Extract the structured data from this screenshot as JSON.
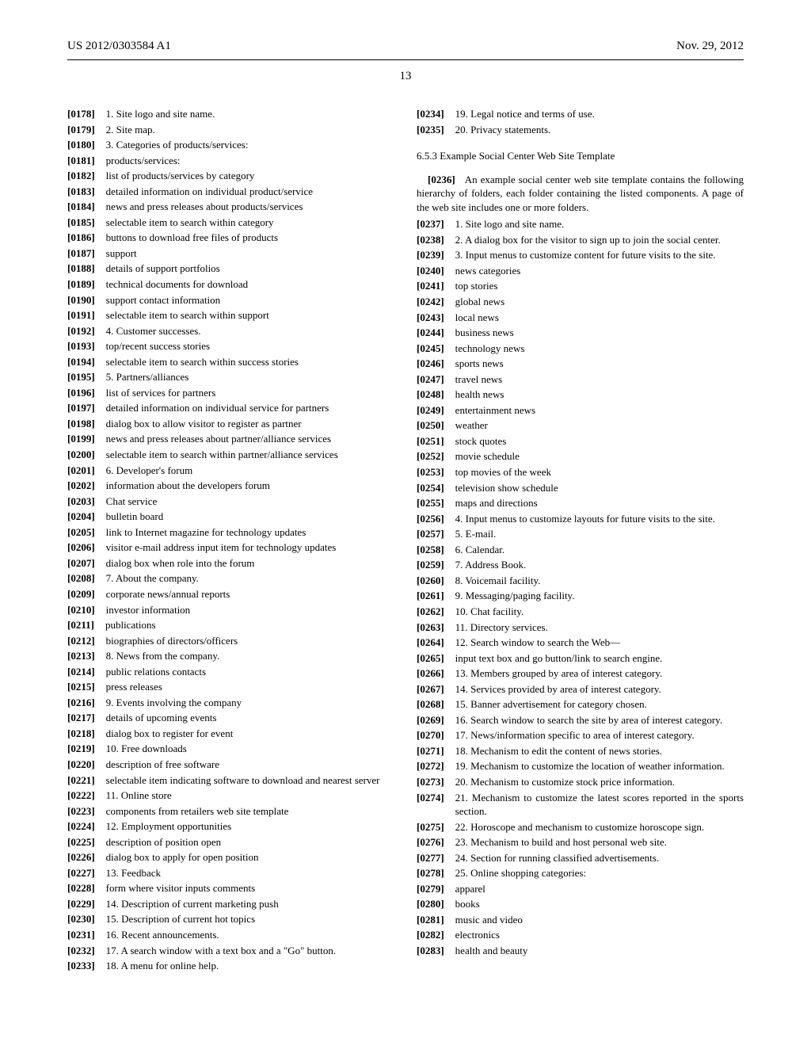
{
  "header": {
    "pubno": "US 2012/0303584 A1",
    "date": "Nov. 29, 2012",
    "page": "13"
  },
  "section_title": "6.5.3 Example Social Center Web Site Template",
  "c1": [
    {
      "n": "[0178]",
      "t": "1. Site logo and site name.",
      "i": 0
    },
    {
      "n": "[0179]",
      "t": "2. Site map.",
      "i": 0
    },
    {
      "n": "[0180]",
      "t": "3. Categories of products/services:",
      "i": 0
    },
    {
      "n": "[0181]",
      "t": "products/services:",
      "i": 1
    },
    {
      "n": "[0182]",
      "t": "list of products/services by category",
      "i": 2
    },
    {
      "n": "[0183]",
      "t": "detailed information on individual product/service",
      "i": 2,
      "cont": 2
    },
    {
      "n": "[0184]",
      "t": "news and press releases about products/services",
      "i": 2,
      "cont": 2
    },
    {
      "n": "[0185]",
      "t": "selectable item to search within category",
      "i": 2
    },
    {
      "n": "[0186]",
      "t": "buttons to download free files of products",
      "i": 2
    },
    {
      "n": "[0187]",
      "t": "support",
      "i": 1
    },
    {
      "n": "[0188]",
      "t": "details of support portfolios",
      "i": 1
    },
    {
      "n": "[0189]",
      "t": "technical documents for download",
      "i": 1
    },
    {
      "n": "[0190]",
      "t": "support contact information",
      "i": 1
    },
    {
      "n": "[0191]",
      "t": "selectable item to search within support",
      "i": 2
    },
    {
      "n": "[0192]",
      "t": "4. Customer successes.",
      "i": 0
    },
    {
      "n": "[0193]",
      "t": "top/recent success stories",
      "i": 1
    },
    {
      "n": "[0194]",
      "t": "selectable item to search within success stories",
      "i": 2
    },
    {
      "n": "[0195]",
      "t": "5. Partners/alliances",
      "i": 0
    },
    {
      "n": "[0196]",
      "t": "list of services for partners",
      "i": 1
    },
    {
      "n": "[0197]",
      "t": "detailed information on individual service for partners",
      "i": 1,
      "cont": 1
    },
    {
      "n": "[0198]",
      "t": "dialog box to allow visitor to register as partner",
      "i": 1
    },
    {
      "n": "[0199]",
      "t": "news and press releases about partner/alliance services",
      "i": 1,
      "cont": 1
    },
    {
      "n": "[0200]",
      "t": "selectable item to search within partner/alliance services",
      "i": 1,
      "cont": 1
    },
    {
      "n": "[0201]",
      "t": "6. Developer's forum",
      "i": 0
    },
    {
      "n": "[0202]",
      "t": "information about the developers forum",
      "i": 1
    },
    {
      "n": "[0203]",
      "t": "Chat service",
      "i": 1
    },
    {
      "n": "[0204]",
      "t": "bulletin board",
      "i": 1
    },
    {
      "n": "[0205]",
      "t": "link to Internet magazine for technology updates",
      "i": 1
    },
    {
      "n": "[0206]",
      "t": "visitor e-mail address input item for technology updates",
      "i": 1,
      "cont": 1
    },
    {
      "n": "[0207]",
      "t": "dialog box when role into the forum",
      "i": 1
    },
    {
      "n": "[0208]",
      "t": "7. About the company.",
      "i": 0
    },
    {
      "n": "[0209]",
      "t": "corporate news/annual reports",
      "i": 1
    },
    {
      "n": "[0210]",
      "t": "investor information",
      "i": 1
    },
    {
      "n": "[0211]",
      "t": "publications",
      "i": 1
    },
    {
      "n": "[0212]",
      "t": "biographies of directors/officers",
      "i": 1
    },
    {
      "n": "[0213]",
      "t": "8. News from the company.",
      "i": 0
    },
    {
      "n": "[0214]",
      "t": "public relations contacts",
      "i": 1
    },
    {
      "n": "[0215]",
      "t": "press releases",
      "i": 1
    },
    {
      "n": "[0216]",
      "t": "9. Events involving the company",
      "i": 0
    },
    {
      "n": "[0217]",
      "t": "details of upcoming events",
      "i": 1
    },
    {
      "n": "[0218]",
      "t": "dialog box to register for event",
      "i": 1
    },
    {
      "n": "[0219]",
      "t": "10. Free downloads",
      "i": 0
    },
    {
      "n": "[0220]",
      "t": "description of free software",
      "i": 1
    },
    {
      "n": "[0221]",
      "t": "selectable item indicating software to download and nearest server",
      "i": 1,
      "cont": 1
    },
    {
      "n": "[0222]",
      "t": "11. Online store",
      "i": 0
    },
    {
      "n": "[0223]",
      "t": "components from retailers web site template",
      "i": 1
    },
    {
      "n": "[0224]",
      "t": "12. Employment opportunities",
      "i": 0
    },
    {
      "n": "[0225]",
      "t": "description of position open",
      "i": 1
    },
    {
      "n": "[0226]",
      "t": "dialog box to apply for open position",
      "i": 1
    },
    {
      "n": "[0227]",
      "t": "13. Feedback",
      "i": 0
    },
    {
      "n": "[0228]",
      "t": "form where visitor inputs comments",
      "i": 1
    },
    {
      "n": "[0229]",
      "t": "14. Description of current marketing push",
      "i": 0
    },
    {
      "n": "[0230]",
      "t": "15. Description of current hot topics",
      "i": 0
    },
    {
      "n": "[0231]",
      "t": "16. Recent announcements.",
      "i": 0
    },
    {
      "n": "[0232]",
      "t": "17. A search window with a text box and a \"Go\" button.",
      "i": 0,
      "cont": 0
    },
    {
      "n": "[0233]",
      "t": "18. A menu for online help.",
      "i": 0
    }
  ],
  "c2_top": [
    {
      "n": "[0234]",
      "t": "19. Legal notice and terms of use.",
      "i": 0
    },
    {
      "n": "[0235]",
      "t": "20. Privacy statements.",
      "i": 0
    }
  ],
  "intro": "An example social center web site template contains the following hierarchy of folders, each folder containing the listed components. A page of the web site includes one or more folders.",
  "intro_num": "[0236]",
  "c2": [
    {
      "n": "[0237]",
      "t": "1. Site logo and site name.",
      "i": 0
    },
    {
      "n": "[0238]",
      "t": "2. A dialog box for the visitor to sign up to join the social center.",
      "i": 0,
      "cont": 0
    },
    {
      "n": "[0239]",
      "t": "3. Input menus to customize content for future visits to the site.",
      "i": 0,
      "cont": 0
    },
    {
      "n": "[0240]",
      "t": "news categories",
      "i": 1
    },
    {
      "n": "[0241]",
      "t": "top stories",
      "i": 2
    },
    {
      "n": "[0242]",
      "t": "global news",
      "i": 2
    },
    {
      "n": "[0243]",
      "t": "local news",
      "i": 2
    },
    {
      "n": "[0244]",
      "t": "business news",
      "i": 2
    },
    {
      "n": "[0245]",
      "t": "technology news",
      "i": 2
    },
    {
      "n": "[0246]",
      "t": "sports news",
      "i": 2
    },
    {
      "n": "[0247]",
      "t": "travel news",
      "i": 2
    },
    {
      "n": "[0248]",
      "t": "health news",
      "i": 2
    },
    {
      "n": "[0249]",
      "t": "entertainment news",
      "i": 2
    },
    {
      "n": "[0250]",
      "t": "weather",
      "i": 1
    },
    {
      "n": "[0251]",
      "t": "stock quotes",
      "i": 1
    },
    {
      "n": "[0252]",
      "t": "movie schedule",
      "i": 1
    },
    {
      "n": "[0253]",
      "t": "top movies of the week",
      "i": 1
    },
    {
      "n": "[0254]",
      "t": "television show schedule",
      "i": 1
    },
    {
      "n": "[0255]",
      "t": "maps and directions",
      "i": 1
    },
    {
      "n": "[0256]",
      "t": "4. Input menus to customize layouts for future visits to the site.",
      "i": 0,
      "cont": 0
    },
    {
      "n": "[0257]",
      "t": "5. E-mail.",
      "i": 0
    },
    {
      "n": "[0258]",
      "t": "6. Calendar.",
      "i": 0
    },
    {
      "n": "[0259]",
      "t": "7. Address Book.",
      "i": 0
    },
    {
      "n": "[0260]",
      "t": "8. Voicemail facility.",
      "i": 0
    },
    {
      "n": "[0261]",
      "t": "9. Messaging/paging facility.",
      "i": 0
    },
    {
      "n": "[0262]",
      "t": "10. Chat facility.",
      "i": 0
    },
    {
      "n": "[0263]",
      "t": "11. Directory services.",
      "i": 0
    },
    {
      "n": "[0264]",
      "t": "12. Search window to search the Web—",
      "i": 0
    },
    {
      "n": "[0265]",
      "t": "input text box and go button/link to search engine.",
      "i": 1
    },
    {
      "n": "[0266]",
      "t": "13. Members grouped by area of interest category.",
      "i": 0
    },
    {
      "n": "[0267]",
      "t": "14. Services provided by area of interest category.",
      "i": 0
    },
    {
      "n": "[0268]",
      "t": "15. Banner advertisement for category chosen.",
      "i": 0
    },
    {
      "n": "[0269]",
      "t": "16. Search window to search the site by area of interest category.",
      "i": 0,
      "cont": 0
    },
    {
      "n": "[0270]",
      "t": "17. News/information specific to area of interest category.",
      "i": 0,
      "cont": 0
    },
    {
      "n": "[0271]",
      "t": "18. Mechanism to edit the content of news stories.",
      "i": 0
    },
    {
      "n": "[0272]",
      "t": "19. Mechanism to customize the location of weather information.",
      "i": 0,
      "cont": 0
    },
    {
      "n": "[0273]",
      "t": "20. Mechanism to customize stock price information.",
      "i": 0,
      "cont": 0
    },
    {
      "n": "[0274]",
      "t": "21. Mechanism to customize the latest scores reported in the sports section.",
      "i": 0,
      "cont": 0
    },
    {
      "n": "[0275]",
      "t": "22. Horoscope and mechanism to customize horoscope sign.",
      "i": 0,
      "cont": 0
    },
    {
      "n": "[0276]",
      "t": "23. Mechanism to build and host personal web site.",
      "i": 0
    },
    {
      "n": "[0277]",
      "t": "24. Section for running classified advertisements.",
      "i": 0
    },
    {
      "n": "[0278]",
      "t": "25. Online shopping categories:",
      "i": 0
    },
    {
      "n": "[0279]",
      "t": "apparel",
      "i": 1
    },
    {
      "n": "[0280]",
      "t": "books",
      "i": 1
    },
    {
      "n": "[0281]",
      "t": "music and video",
      "i": 1
    },
    {
      "n": "[0282]",
      "t": "electronics",
      "i": 1
    },
    {
      "n": "[0283]",
      "t": "health and beauty",
      "i": 1
    }
  ]
}
